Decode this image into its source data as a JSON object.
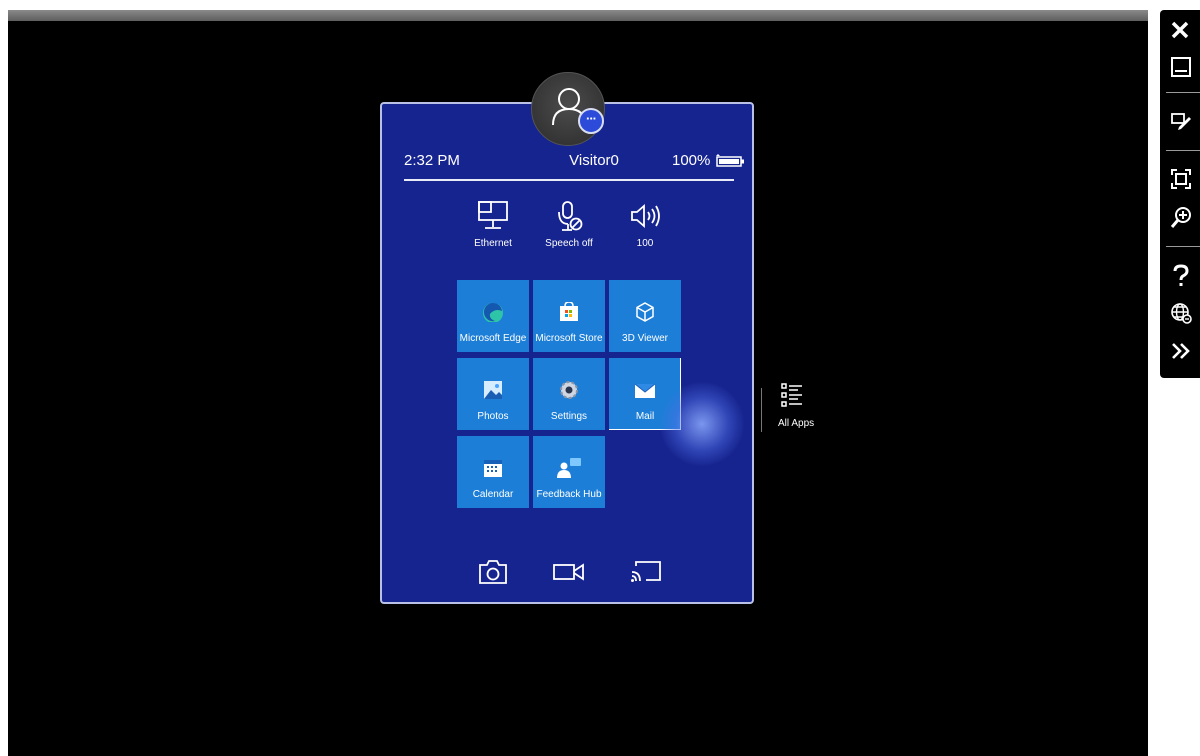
{
  "status": {
    "time": "2:32 PM",
    "user": "Visitor0",
    "battery": "100%"
  },
  "quick_settings": [
    {
      "label": "Ethernet",
      "icon": "ethernet-icon"
    },
    {
      "label": "Speech off",
      "icon": "microphone-off-icon"
    },
    {
      "label": "100",
      "icon": "volume-icon"
    }
  ],
  "tiles": [
    {
      "label": "Microsoft Edge",
      "icon": "edge-icon"
    },
    {
      "label": "Microsoft Store",
      "icon": "store-icon"
    },
    {
      "label": "3D Viewer",
      "icon": "cube-icon"
    },
    {
      "label": "Photos",
      "icon": "photos-icon"
    },
    {
      "label": "Settings",
      "icon": "gear-icon"
    },
    {
      "label": "Mail",
      "icon": "mail-icon"
    },
    {
      "label": "Calendar",
      "icon": "calendar-icon"
    },
    {
      "label": "Feedback Hub",
      "icon": "feedback-icon"
    }
  ],
  "bottom_actions": [
    "camera-icon",
    "video-icon",
    "cast-icon"
  ],
  "all_apps": {
    "label": "All Apps"
  },
  "toolbar": [
    "close-icon",
    "minimize-icon",
    "edit-icon",
    "fit-icon",
    "zoom-icon",
    "help-icon",
    "globe-icon",
    "expand-icon"
  ],
  "colors": {
    "panel": "#16248f",
    "tile": "#1c7ed7",
    "background": "#000000"
  }
}
